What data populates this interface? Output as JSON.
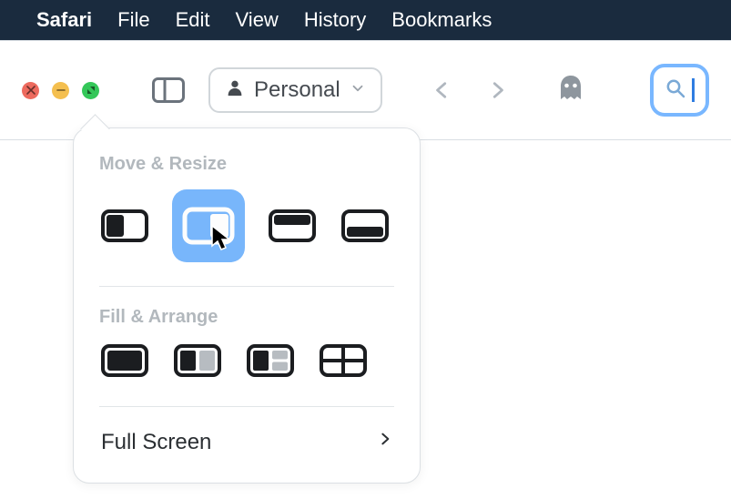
{
  "menubar": {
    "app_name": "Safari",
    "items": [
      "File",
      "Edit",
      "View",
      "History",
      "Bookmarks"
    ]
  },
  "toolbar": {
    "profile_label": "Personal"
  },
  "popover": {
    "section_move_resize": "Move & Resize",
    "section_fill_arrange": "Fill & Arrange",
    "full_screen_label": "Full Screen",
    "move_resize_options": [
      "left-half",
      "right-half",
      "top-half",
      "bottom-half"
    ],
    "fill_arrange_options": [
      "fill",
      "two-up",
      "three-up",
      "grid"
    ],
    "selected_option": "right-half"
  }
}
